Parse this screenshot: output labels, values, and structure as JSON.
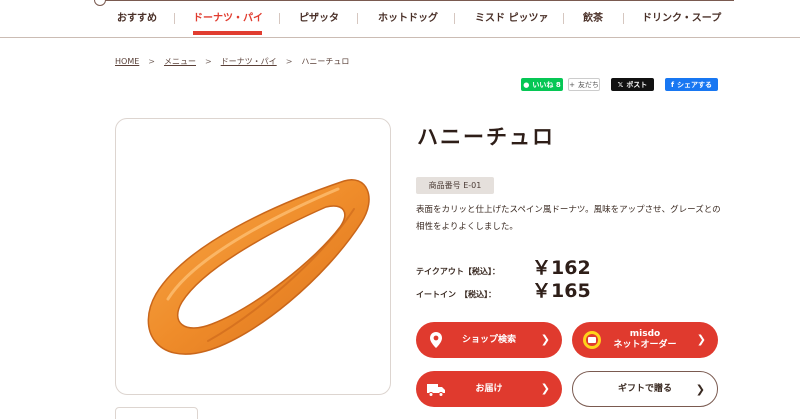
{
  "nav": {
    "items": [
      {
        "label": "おすすめ",
        "active": false
      },
      {
        "label": "ドーナツ・パイ",
        "active": true
      },
      {
        "label": "ピザッタ",
        "active": false
      },
      {
        "label": "ホットドッグ",
        "active": false
      },
      {
        "label": "ミスド ピッツァ",
        "active": false
      },
      {
        "label": "飲茶",
        "active": false
      },
      {
        "label": "ドリンク・スープ",
        "active": false
      }
    ]
  },
  "breadcrumb": [
    "HOME",
    "メニュー",
    "ドーナツ・パイ",
    "ハニーチュロ"
  ],
  "breadcrumb_sep": ">",
  "share": {
    "line": "いいね 8",
    "friend": "友だち",
    "x": "ポスト",
    "fb": "シェアする"
  },
  "product": {
    "name": "ハニーチュロ",
    "code": "商品番号 E-01",
    "description": "表面をカリッと仕上げたスペイン風ドーナツ。風味をアップさせ、グレーズとの相性をよりよくしました。",
    "prices": {
      "takeout_label": "テイクアウト【税込】：",
      "takeout_value": "￥162",
      "eatin_label": "イートイン　【税込】：",
      "eatin_value": "￥165"
    }
  },
  "actions": {
    "shop_search": "ショップ検索",
    "net_order_line1": "misdo",
    "net_order_line2": "ネットオーダー",
    "delivery": "お届け",
    "gift": "ギフトで贈る"
  },
  "colors": {
    "accent": "#e03a2e",
    "text": "#3a2a22",
    "line": "#06c755",
    "facebook": "#1877f2"
  }
}
